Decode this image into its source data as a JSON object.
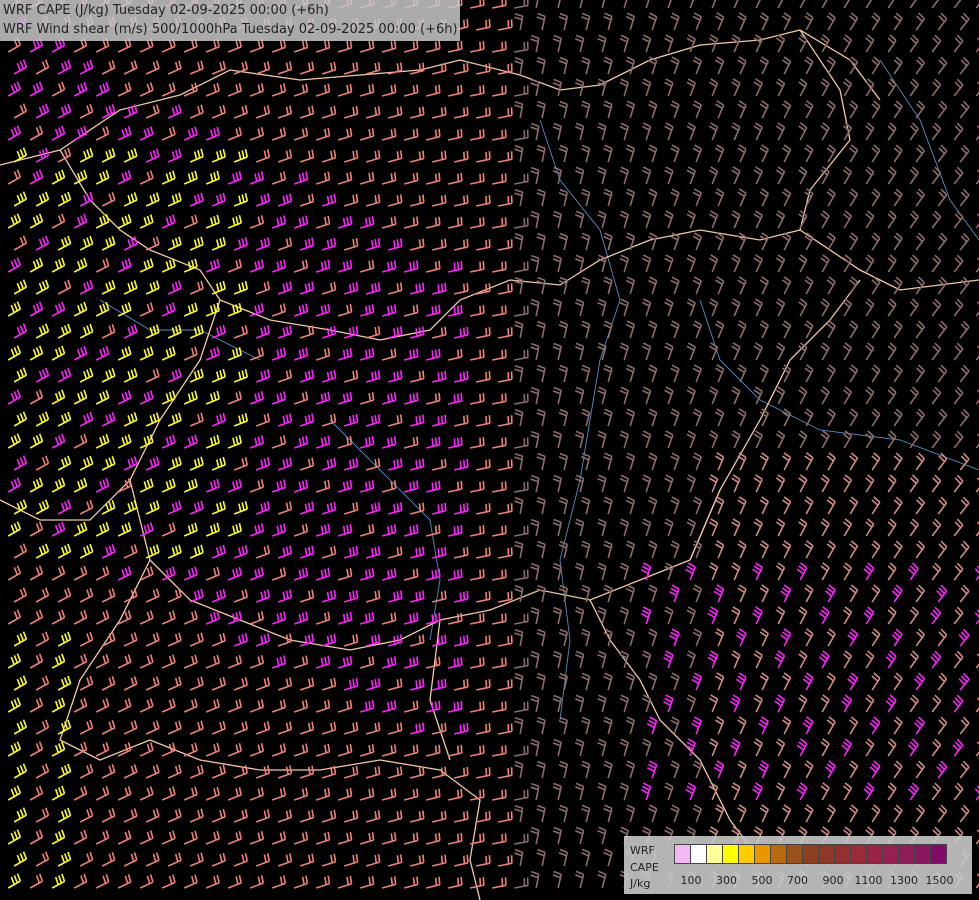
{
  "header": {
    "title_line1": "WRF CAPE (J/kg) Tuesday 02-09-2025 00:00 (+6h)",
    "title_line2": "WRF Wind shear (m/s) 500/1000hPa Tuesday 02-09-2025 00:00 (+6h)"
  },
  "legend": {
    "label_line1": "WRF",
    "label_line2": "CAPE",
    "label_line3": "J/kg",
    "colors": [
      "#f2b8f2",
      "#ffffff",
      "#ffff99",
      "#ffff00",
      "#ffcc00",
      "#e89600",
      "#b86a10",
      "#9a5018",
      "#8c4020",
      "#903828",
      "#943030",
      "#9a2c3a",
      "#9a2444",
      "#962050",
      "#901c58",
      "#8a1860",
      "#800c68"
    ],
    "ticks": [
      "100",
      "300",
      "500",
      "700",
      "900",
      "1100",
      "1300",
      "1500"
    ]
  },
  "map": {
    "barb_colors": {
      "low": "#8e6c6c",
      "mid": "#f08078",
      "high": "#ff22ff",
      "cape": "#ffff22"
    },
    "border_color": "#f0c8a0",
    "river_color": "#5a8ac0"
  }
}
